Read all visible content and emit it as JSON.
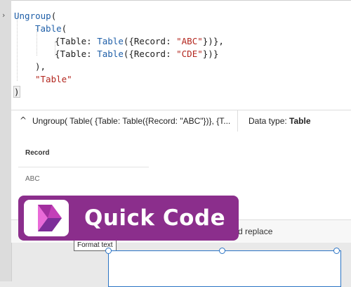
{
  "code": {
    "line1": {
      "fn": "Ungroup",
      "paren": "("
    },
    "line2": {
      "fn": "Table",
      "paren": "("
    },
    "line3": {
      "open": "{Table: ",
      "fn": "Table",
      "mid": "({Record: ",
      "str": "\"ABC\"",
      "close": "})},"
    },
    "line4": {
      "open": "{Table: ",
      "fn": "Table",
      "mid": "({Record: ",
      "str": "\"CDE\"",
      "close": "})}"
    },
    "line5": {
      "text": "),"
    },
    "line6": {
      "str": "\"Table\""
    },
    "line7": {
      "text": ")"
    }
  },
  "formula_bar": {
    "expression": "Ungroup( Table( {Table: Table({Record: \"ABC\"})}, {T...",
    "data_type_label": "Data type:",
    "data_type_value": "Table"
  },
  "results": {
    "column_header": "Record",
    "cells": [
      "ABC"
    ]
  },
  "toolbar": {
    "find_replace_fragment": "d replace"
  },
  "tooltip": {
    "text": "Format text"
  },
  "badge": {
    "text": "Quick Code"
  },
  "colors": {
    "badge_background": "#8b2e8c",
    "function_blue": "#1f5fa8",
    "string_red": "#b3261e",
    "selection_blue": "#2b74c4"
  },
  "icons": {
    "left_rail": "chevron-right-icon",
    "formula_bar": "chevron-up-icon",
    "badge_logo": "power-apps-logo-icon"
  }
}
